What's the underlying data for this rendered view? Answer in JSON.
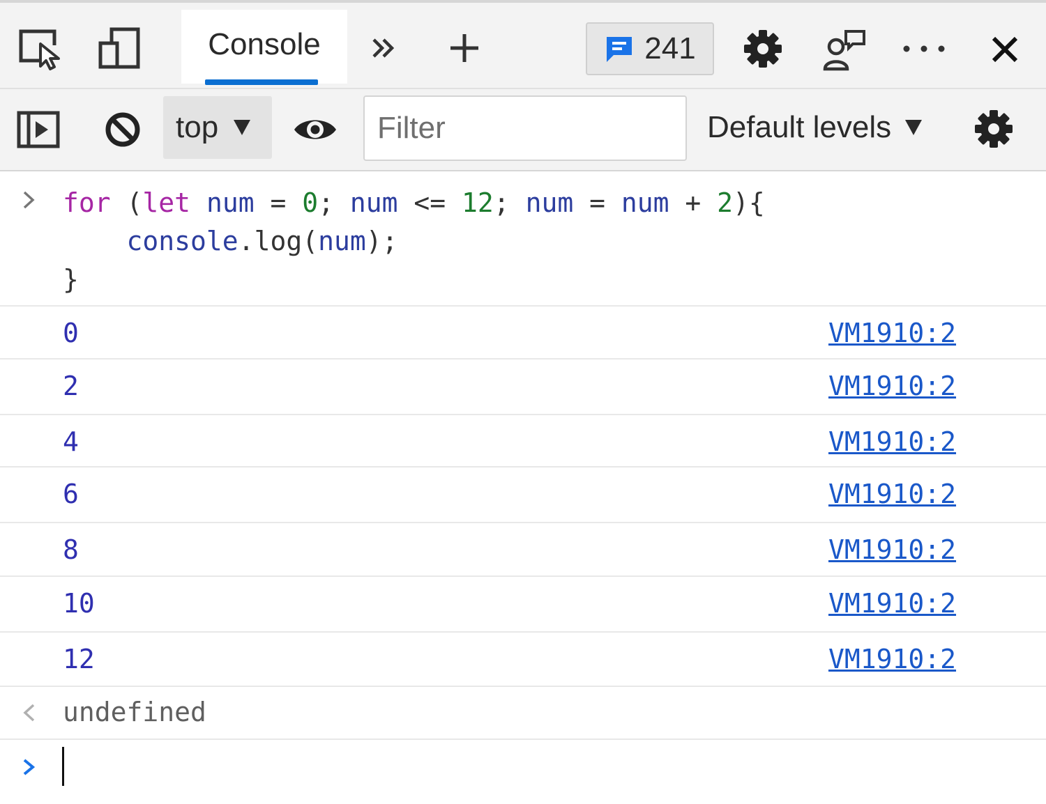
{
  "tabbar": {
    "console_tab": "Console",
    "message_count": "241",
    "accent": "#0a6ed1"
  },
  "toolbar": {
    "context": "top",
    "filter_placeholder": "Filter",
    "levels": "Default levels"
  },
  "input": {
    "line1": [
      {
        "t": "for",
        "c": "kw"
      },
      {
        "t": " (",
        "c": "punc"
      },
      {
        "t": "let",
        "c": "kw"
      },
      {
        "t": " ",
        "c": "punc"
      },
      {
        "t": "num",
        "c": "var"
      },
      {
        "t": " = ",
        "c": "punc"
      },
      {
        "t": "0",
        "c": "num"
      },
      {
        "t": "; ",
        "c": "punc"
      },
      {
        "t": "num",
        "c": "var"
      },
      {
        "t": " <= ",
        "c": "punc"
      },
      {
        "t": "12",
        "c": "num"
      },
      {
        "t": "; ",
        "c": "punc"
      },
      {
        "t": "num",
        "c": "var"
      },
      {
        "t": " = ",
        "c": "punc"
      },
      {
        "t": "num",
        "c": "var"
      },
      {
        "t": " + ",
        "c": "punc"
      },
      {
        "t": "2",
        "c": "num"
      },
      {
        "t": "){",
        "c": "punc"
      }
    ],
    "line2": [
      {
        "t": "    console",
        "c": "var"
      },
      {
        "t": ".",
        "c": "punc"
      },
      {
        "t": "log",
        "c": "punc"
      },
      {
        "t": "(",
        "c": "punc"
      },
      {
        "t": "num",
        "c": "var"
      },
      {
        "t": ");",
        "c": "punc"
      }
    ],
    "line3": [
      {
        "t": "}",
        "c": "punc"
      }
    ]
  },
  "outputs": [
    {
      "value": "0",
      "source": "VM1910:2"
    },
    {
      "value": "2",
      "source": "VM1910:2"
    },
    {
      "value": "4",
      "source": "VM1910:2"
    },
    {
      "value": "6",
      "source": "VM1910:2"
    },
    {
      "value": "8",
      "source": "VM1910:2"
    },
    {
      "value": "10",
      "source": "VM1910:2"
    },
    {
      "value": "12",
      "source": "VM1910:2"
    }
  ],
  "result": "undefined"
}
